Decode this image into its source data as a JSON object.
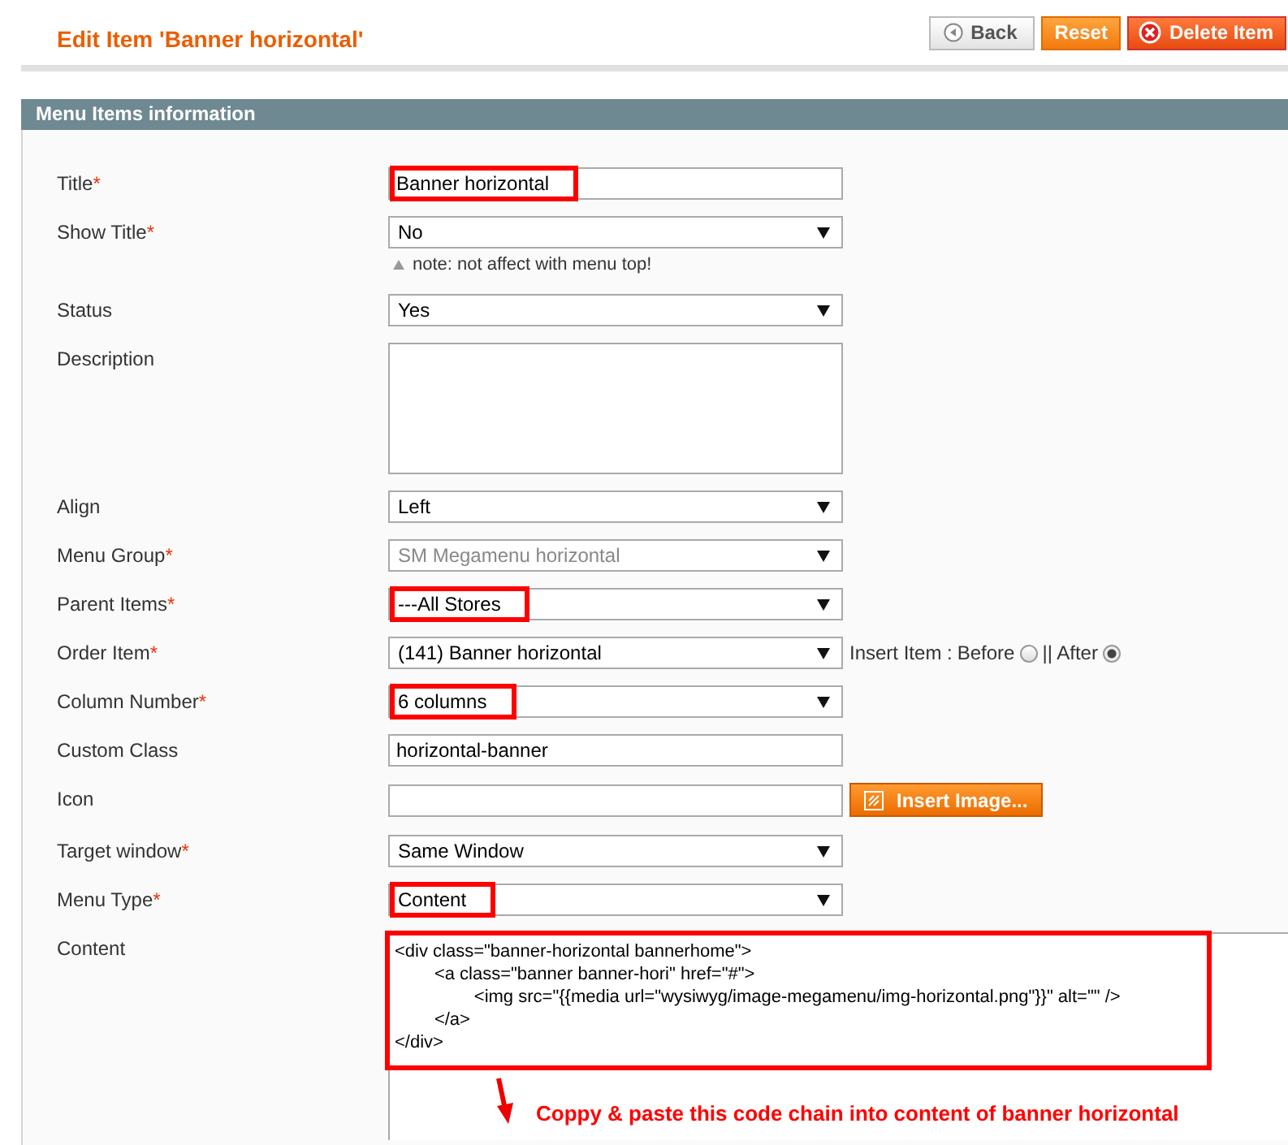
{
  "header": {
    "title": "Edit Item 'Banner horizontal'",
    "buttons": [
      {
        "label": "Back",
        "kind": "back"
      },
      {
        "label": "Reset",
        "kind": "reset"
      },
      {
        "label": "Delete Item",
        "kind": "delete"
      }
    ]
  },
  "section": {
    "title": "Menu Items information"
  },
  "fields": [
    {
      "kind": "text",
      "label": "Title",
      "marker": "*",
      "value": "Banner horizontal",
      "highlighted": true
    },
    {
      "kind": "select",
      "label": "Show Title",
      "marker": "*",
      "value": "No",
      "highlighted": false,
      "note": "note: not affect with menu top!"
    },
    {
      "kind": "select",
      "label": "Status",
      "value": "Yes",
      "highlighted": false
    },
    {
      "kind": "textarea",
      "label": "Description"
    },
    {
      "kind": "select",
      "label": "Align",
      "value": "Left",
      "highlighted": false
    },
    {
      "kind": "select",
      "label": "Menu Group",
      "marker": "*",
      "value": "SM Megamenu horizontal",
      "highlighted": false,
      "disabled": true
    },
    {
      "kind": "select",
      "label": "Parent Items",
      "marker": "*",
      "value": "---All Stores",
      "highlighted": true
    },
    {
      "kind": "select",
      "label": "Order Item",
      "marker": "*",
      "value": "(141) Banner horizontal",
      "highlighted": false,
      "insert": {
        "label": "Insert Item :",
        "options": [
          {
            "label": "Before",
            "selected": false
          },
          {
            "label": "|| After",
            "selected": true
          }
        ]
      }
    },
    {
      "kind": "select",
      "label": "Column Number",
      "marker": "*",
      "value": "6 columns",
      "highlighted": true
    },
    {
      "kind": "text",
      "label": "Custom Class",
      "value": "horizontal-banner",
      "highlighted": false
    },
    {
      "kind": "image",
      "label": "Icon",
      "button": "Insert Image..."
    },
    {
      "kind": "select",
      "label": "Target window",
      "marker": "*",
      "value": "Same Window",
      "highlighted": false
    },
    {
      "kind": "select",
      "label": "Menu Type",
      "marker": "*",
      "value": "Content",
      "highlighted": true
    },
    {
      "kind": "code",
      "label": "Content",
      "highlighted": true,
      "lines": [
        "<div class=\"banner-horizontal bannerhome\">",
        "        <a class=\"banner banner-hori\" href=\"#\">",
        "                <img src=\"{{media url=\"wysiwyg/image-megamenu/img-horizontal.png\"}}\" alt=\"\" />",
        "        </a>",
        "</div>"
      ],
      "annotation": "Coppy & paste this code chain into content of banner horizontal"
    }
  ]
}
